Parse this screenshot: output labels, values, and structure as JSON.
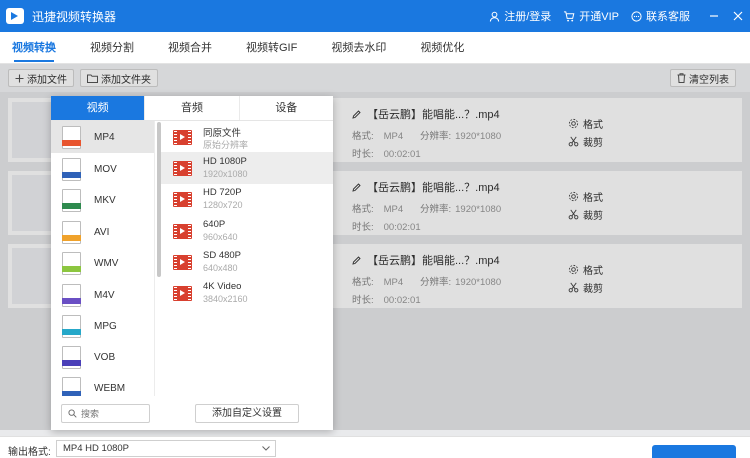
{
  "window": {
    "title": "迅捷视频转换器"
  },
  "header": {
    "register_label": "注册/登录",
    "vip_label": "开通VIP",
    "service_label": "联系客服"
  },
  "tabs": [
    {
      "label": "视频转换",
      "active": true
    },
    {
      "label": "视频分割"
    },
    {
      "label": "视频合并"
    },
    {
      "label": "视频转GIF"
    },
    {
      "label": "视频去水印"
    },
    {
      "label": "视频优化"
    }
  ],
  "toolbar": {
    "add_file": "添加文件",
    "add_folder": "添加文件夹",
    "clear_list": "清空列表"
  },
  "files": [
    {
      "name": "【岳云鹏】能唱能...？.mp4",
      "format_label": "格式:",
      "format": "MP4",
      "resolution_label": "分辨率:",
      "resolution": "1920*1080",
      "duration_label": "时长:",
      "duration": "00:02:01",
      "format_action": "格式",
      "trim_action": "裁剪"
    },
    {
      "name": "【岳云鹏】能唱能...？.mp4",
      "format_label": "格式:",
      "format": "MP4",
      "resolution_label": "分辨率:",
      "resolution": "1920*1080",
      "duration_label": "时长:",
      "duration": "00:02:01",
      "format_action": "格式",
      "trim_action": "裁剪"
    },
    {
      "name": "【岳云鹏】能唱能...？.mp4",
      "format_label": "格式:",
      "format": "MP4",
      "resolution_label": "分辨率:",
      "resolution": "1920*1080",
      "duration_label": "时长:",
      "duration": "00:02:01",
      "format_action": "格式",
      "trim_action": "裁剪"
    }
  ],
  "format_popup": {
    "tabs": [
      {
        "label": "视频",
        "active": true
      },
      {
        "label": "音频"
      },
      {
        "label": "设备"
      }
    ],
    "formats": [
      {
        "label": "MP4",
        "color": "#e8552f",
        "selected": true
      },
      {
        "label": "MOV",
        "color": "#2f62b8"
      },
      {
        "label": "MKV",
        "color": "#2e8a4e"
      },
      {
        "label": "AVI",
        "color": "#f0a22b"
      },
      {
        "label": "WMV",
        "color": "#8cc63f"
      },
      {
        "label": "M4V",
        "color": "#6a4fc4"
      },
      {
        "label": "MPG",
        "color": "#26a8c9"
      },
      {
        "label": "VOB",
        "color": "#4a3fb8"
      },
      {
        "label": "WEBM",
        "color": "#2f62b8"
      }
    ],
    "presets": [
      {
        "title": "同原文件",
        "subtitle": "原始分辨率"
      },
      {
        "title": "HD 1080P",
        "subtitle": "1920x1080",
        "selected": true
      },
      {
        "title": "HD 720P",
        "subtitle": "1280x720"
      },
      {
        "title": "640P",
        "subtitle": "960x640"
      },
      {
        "title": "SD 480P",
        "subtitle": "640x480"
      },
      {
        "title": "4K Video",
        "subtitle": "3840x2160"
      }
    ],
    "search_placeholder": "搜索",
    "custom_settings": "添加自定义设置"
  },
  "bottom": {
    "output_label": "输出格式:",
    "output_value": "MP4  HD 1080P"
  },
  "colors": {
    "accent": "#1a78e0",
    "film": "#d8402f"
  }
}
